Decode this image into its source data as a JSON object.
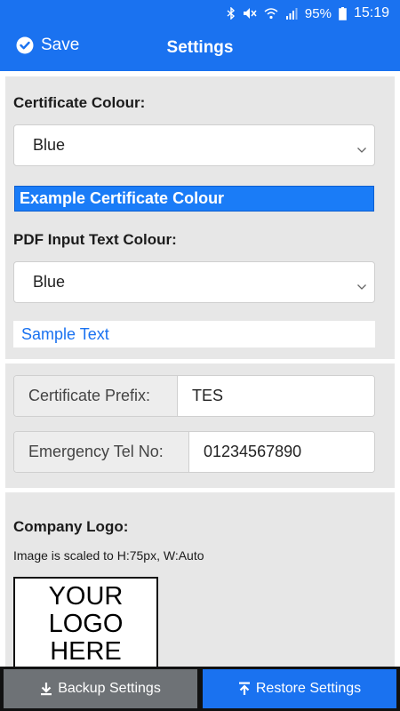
{
  "status_bar": {
    "battery": "95%",
    "time": "15:19",
    "icons": [
      "bluetooth-icon",
      "mute-icon",
      "wifi-icon",
      "signal-icon",
      "battery-icon"
    ]
  },
  "app_bar": {
    "save_label": "Save",
    "title": "Settings",
    "background": "#1a72f0"
  },
  "certificate_colour": {
    "label": "Certificate Colour:",
    "selected": "Blue",
    "example_label": "Example Certificate Colour",
    "example_color": "#1a7cf7"
  },
  "pdf_text_colour": {
    "label": "PDF Input Text Colour:",
    "selected": "Blue",
    "sample_text": "Sample Text"
  },
  "certificate_prefix": {
    "label": "Certificate Prefix:",
    "value": "TES"
  },
  "emergency_tel": {
    "label": "Emergency Tel No:",
    "value": "01234567890"
  },
  "company_logo": {
    "label": "Company Logo:",
    "hint": "Image is scaled to H:75px, W:Auto",
    "placeholder_lines": [
      "YOUR",
      "LOGO",
      "HERE"
    ]
  },
  "bottom_bar": {
    "backup_label": "Backup Settings",
    "restore_label": "Restore Settings"
  }
}
